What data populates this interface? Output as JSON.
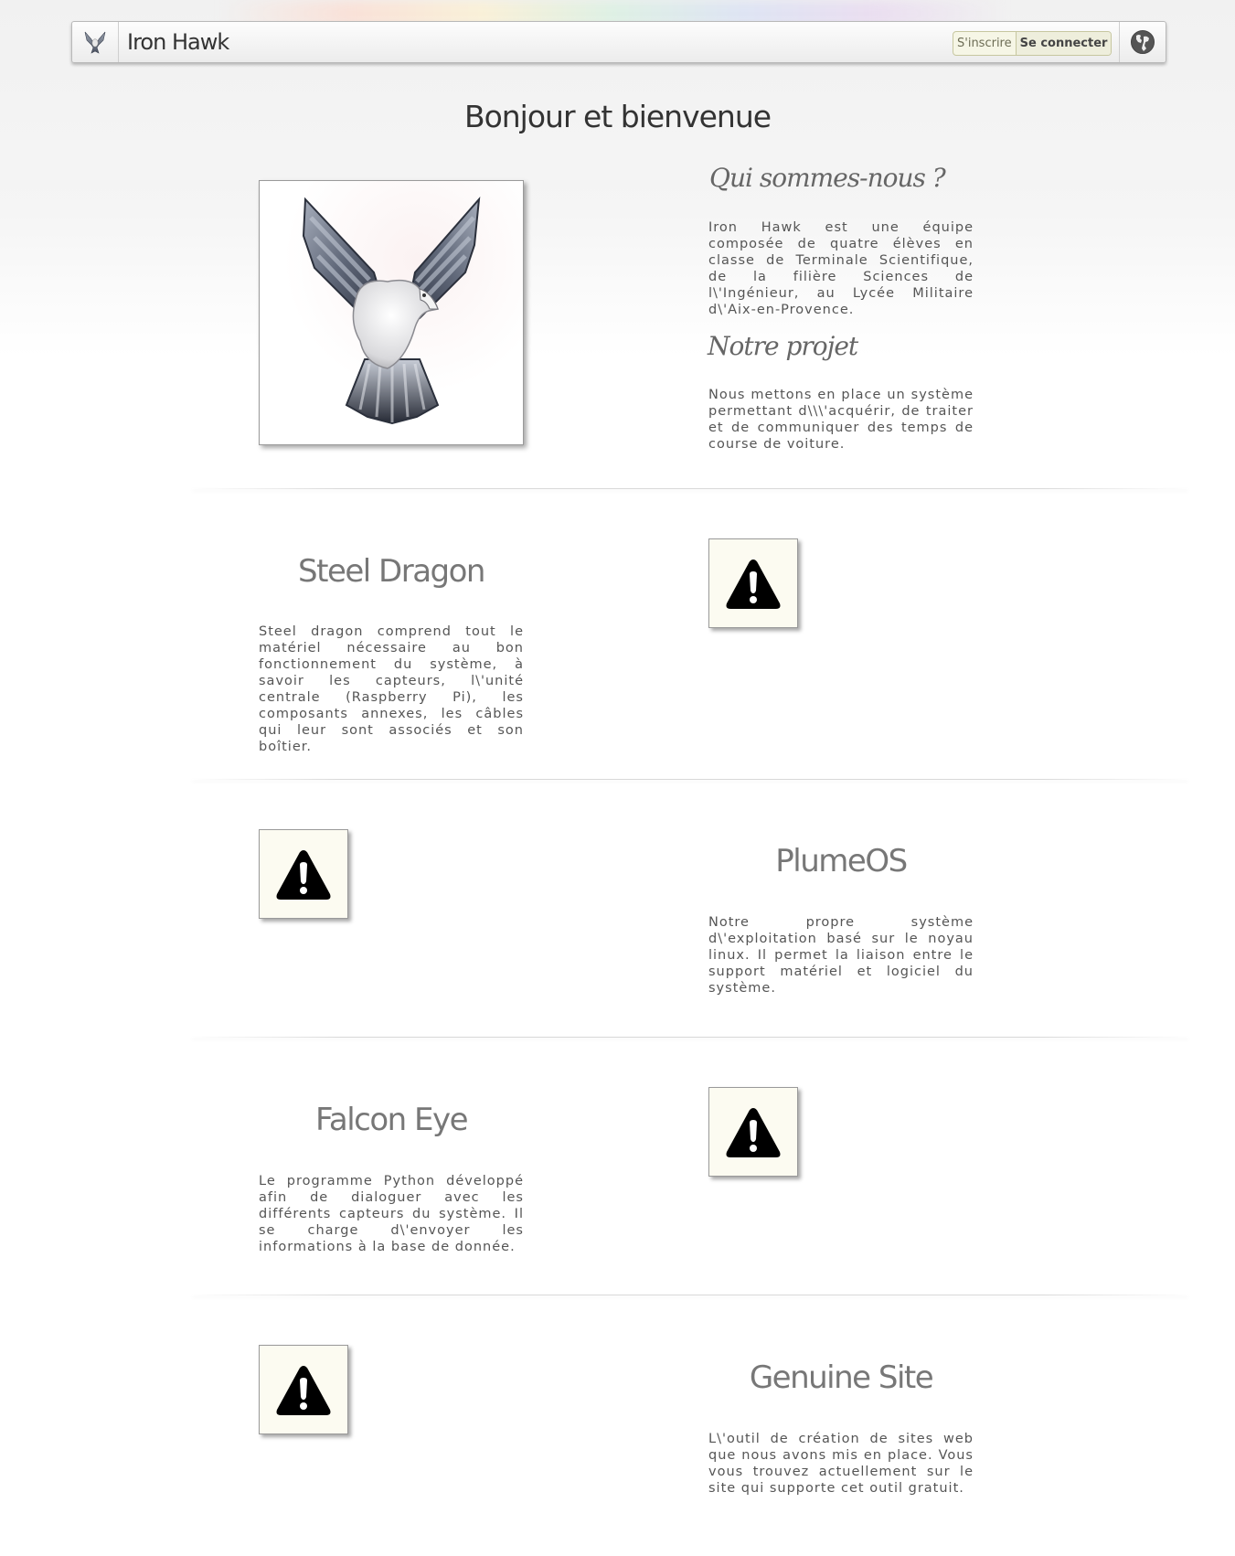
{
  "navbar": {
    "title": "Iron Hawk",
    "signup_label": "S'inscrire",
    "login_label": "Se connecter",
    "logo_icon": "hawk-logo-icon",
    "globe_icon": "globe-icon"
  },
  "welcome": {
    "title": "Bonjour et bienvenue"
  },
  "about": {
    "heading": "Qui sommes-nous ?",
    "text": "Iron Hawk est une équipe composée de quatre élèves en classe de Terminale Scientifique, de la filière Sciences de l\\'Ingénieur, au Lycée Militaire d\\'Aix-en-Provence."
  },
  "project": {
    "heading": "Notre projet",
    "text": "Nous mettons en place un système permettant d\\\\\\'acquérir, de traiter et de communiquer des temps de course de voiture."
  },
  "sections": [
    {
      "title": "Steel Dragon",
      "text": "Steel dragon comprend tout le matériel nécessaire au bon fonctionnement du système, à savoir les capteurs, l\\'unité centrale (Raspberry Pi), les composants annexes, les câbles qui leur sont associés et son boîtier."
    },
    {
      "title": "PlumeOS",
      "text": "Notre propre système d\\'exploitation basé sur le noyau linux. Il permet la liaison entre le support matériel et logiciel du système."
    },
    {
      "title": "Falcon Eye",
      "text": "Le programme Python développé afin de dialoguer avec les différents capteurs du système. Il se charge d\\'envoyer les informations à la base de donnée."
    },
    {
      "title": "Genuine Site",
      "text": "L\\'outil de création de sites web que nous avons mis en place. Vous vous trouvez actuellement sur le site qui supporte cet outil gratuit."
    }
  ],
  "icons": {
    "broken_image": "warning-icon"
  }
}
